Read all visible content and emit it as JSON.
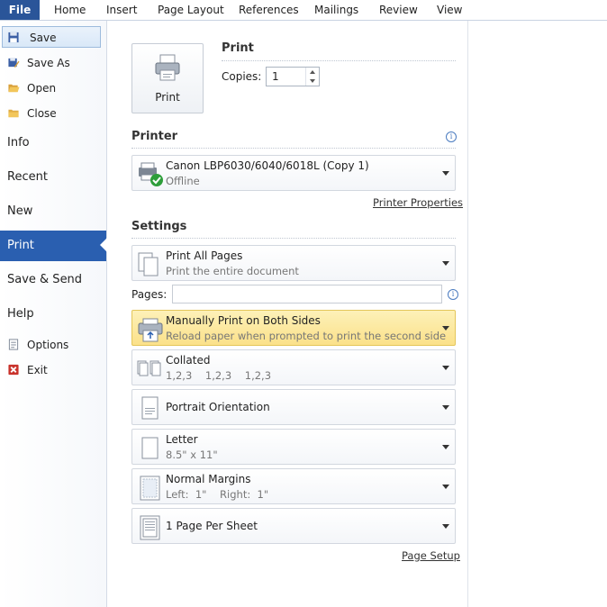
{
  "ribbon": {
    "file": "File",
    "tabs": [
      "Home",
      "Insert",
      "Page Layout",
      "References",
      "Mailings",
      "Review",
      "View"
    ]
  },
  "nav": {
    "save": "Save",
    "save_as": "Save As",
    "open": "Open",
    "close": "Close",
    "info": "Info",
    "recent": "Recent",
    "new": "New",
    "print": "Print",
    "save_send": "Save & Send",
    "help": "Help",
    "options": "Options",
    "exit": "Exit"
  },
  "print_section": {
    "title": "Print",
    "button_label": "Print",
    "copies_label": "Copies:",
    "copies_value": "1"
  },
  "printer_section": {
    "title": "Printer",
    "name": "Canon LBP6030/6040/6018L (Copy 1)",
    "status": "Offline",
    "properties_link": "Printer Properties"
  },
  "settings_section": {
    "title": "Settings",
    "pages_label": "Pages:",
    "pages_value": "",
    "page_setup_link": "Page Setup",
    "items": [
      {
        "main": "Print All Pages",
        "sub": "Print the entire document"
      },
      {
        "main": "Manually Print on Both Sides",
        "sub": "Reload paper when prompted to print the second side"
      },
      {
        "main": "Collated",
        "sub": "1,2,3    1,2,3    1,2,3"
      },
      {
        "main": "Portrait Orientation",
        "sub": ""
      },
      {
        "main": "Letter",
        "sub": "8.5\" x 11\""
      },
      {
        "main": "Normal Margins",
        "sub": "Left:  1\"    Right:  1\""
      },
      {
        "main": "1 Page Per Sheet",
        "sub": ""
      }
    ]
  },
  "colors": {
    "accent": "#2a5fb0",
    "file_tab": "#2a5599",
    "highlight": "#fbe18a",
    "status_ok": "#2e9e3a"
  }
}
